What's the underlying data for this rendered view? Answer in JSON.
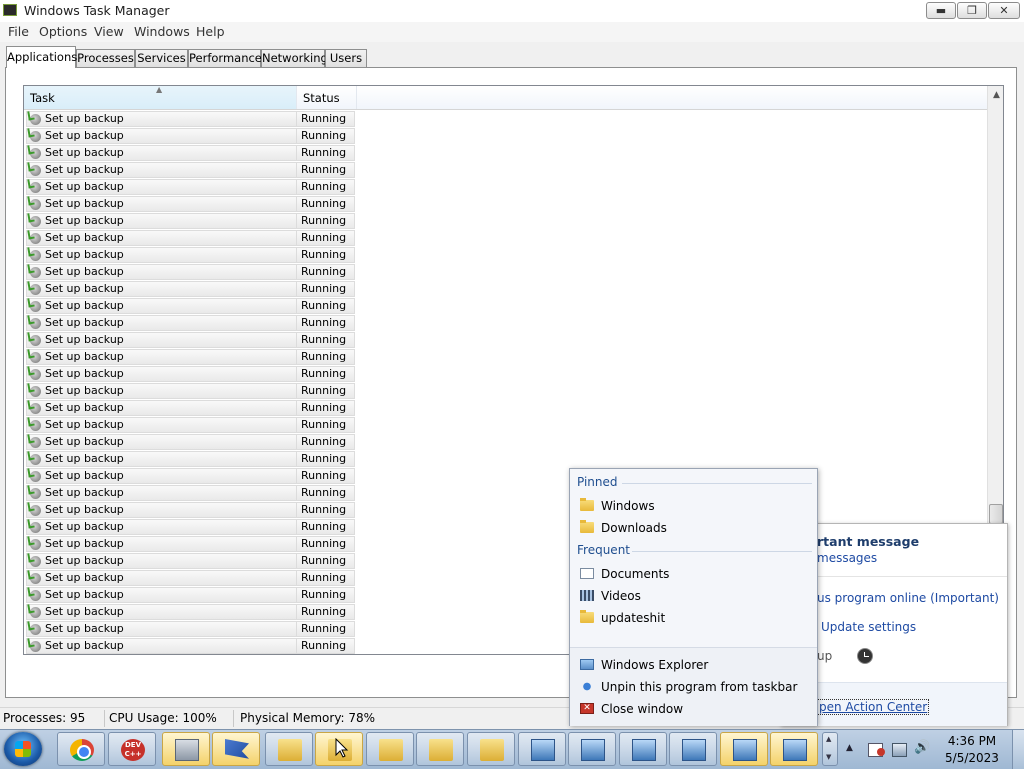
{
  "window": {
    "title": "Windows Task Manager",
    "buttons": {
      "minimize": "▬",
      "restore": "❐",
      "close": "✕"
    }
  },
  "menu": [
    "File",
    "Options",
    "View",
    "Windows",
    "Help"
  ],
  "tabs": [
    "Applications",
    "Processes",
    "Services",
    "Performance",
    "Networking",
    "Users"
  ],
  "table": {
    "columns": [
      "Task",
      "Status"
    ],
    "rows": [
      {
        "task": "Set up backup",
        "status": "Running"
      },
      {
        "task": "Set up backup",
        "status": "Running"
      },
      {
        "task": "Set up backup",
        "status": "Running"
      },
      {
        "task": "Set up backup",
        "status": "Running"
      },
      {
        "task": "Set up backup",
        "status": "Running"
      },
      {
        "task": "Set up backup",
        "status": "Running"
      },
      {
        "task": "Set up backup",
        "status": "Running"
      },
      {
        "task": "Set up backup",
        "status": "Running"
      },
      {
        "task": "Set up backup",
        "status": "Running"
      },
      {
        "task": "Set up backup",
        "status": "Running"
      },
      {
        "task": "Set up backup",
        "status": "Running"
      },
      {
        "task": "Set up backup",
        "status": "Running"
      },
      {
        "task": "Set up backup",
        "status": "Running"
      },
      {
        "task": "Set up backup",
        "status": "Running"
      },
      {
        "task": "Set up backup",
        "status": "Running"
      },
      {
        "task": "Set up backup",
        "status": "Running"
      },
      {
        "task": "Set up backup",
        "status": "Running"
      },
      {
        "task": "Set up backup",
        "status": "Running"
      },
      {
        "task": "Set up backup",
        "status": "Running"
      },
      {
        "task": "Set up backup",
        "status": "Running"
      },
      {
        "task": "Set up backup",
        "status": "Running"
      },
      {
        "task": "Set up backup",
        "status": "Running"
      },
      {
        "task": "Set up backup",
        "status": "Running"
      },
      {
        "task": "Set up backup",
        "status": "Running"
      },
      {
        "task": "Set up backup",
        "status": "Running"
      },
      {
        "task": "Set up backup",
        "status": "Running"
      },
      {
        "task": "Set up backup",
        "status": "Running"
      },
      {
        "task": "Set up backup",
        "status": "Running"
      },
      {
        "task": "Set up backup",
        "status": "Running"
      },
      {
        "task": "Set up backup",
        "status": "Running"
      },
      {
        "task": "Set up backup",
        "status": "Running"
      },
      {
        "task": "Set up backup",
        "status": "Running"
      }
    ]
  },
  "statusbar": {
    "processes": "Processes: 95",
    "cpu": "CPU Usage: 100%",
    "memory": "Physical Memory: 78%"
  },
  "action_center": {
    "title": "rtant message",
    "link1": "messages",
    "link2": "us program online (Important)",
    "link3": "Update settings",
    "link4": "up",
    "footer": "pen Action Center"
  },
  "jumplist": {
    "pinned_label": "Pinned",
    "pinned": [
      "Windows",
      "Downloads"
    ],
    "frequent_label": "Frequent",
    "frequent": [
      "Documents",
      "Videos",
      "updateshit"
    ],
    "tasks": [
      "Windows Explorer",
      "Unpin this program from taskbar",
      "Close window"
    ]
  },
  "taskbar": {
    "dev_label": "DEV C++",
    "time": "4:36 PM",
    "date": "5/5/2023",
    "buttons": [
      "start-orb",
      "chrome-icon",
      "devcpp-icon",
      "disk-icon",
      "flag-icon",
      "folder-icon",
      "folder-icon",
      "folder-icon",
      "folder-icon",
      "folder-icon",
      "monitor-icon",
      "monitor-icon",
      "monitor-icon",
      "monitor-icon",
      "monitor-icon",
      "monitor-icon"
    ]
  },
  "colors": {
    "accent": "#1f4e8f",
    "link": "#1e4aa3",
    "taskbar": "#bfd0e4"
  }
}
